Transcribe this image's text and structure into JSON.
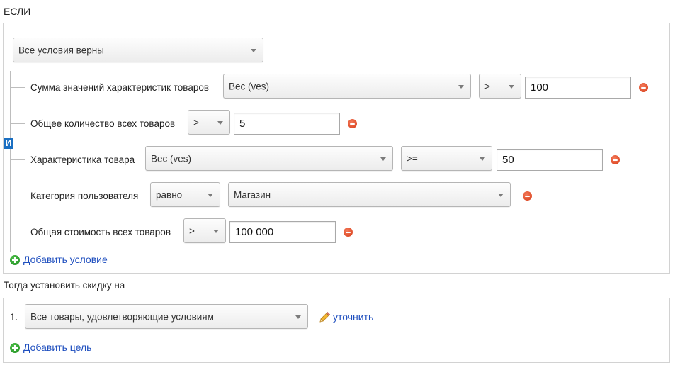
{
  "if_section": {
    "heading": "ЕСЛИ",
    "mode_select": "Все условия верны",
    "and_badge": "И",
    "conditions": [
      {
        "label": "Сумма значений характеристик товаров",
        "attribute": "Вес (ves)",
        "operator": ">",
        "value": "100"
      },
      {
        "label": "Общее количество всех товаров",
        "operator": ">",
        "value": "5"
      },
      {
        "label": "Характеристика товара",
        "attribute": "Вес (ves)",
        "operator": ">=",
        "value": "50"
      },
      {
        "label": "Категория пользователя",
        "operator": "равно",
        "value": "Магазин"
      },
      {
        "label": "Общая стоимость всех товаров",
        "operator": ">",
        "value": "100 000"
      }
    ],
    "add_condition": "Добавить условие"
  },
  "then_section": {
    "heading": "Тогда установить скидку на",
    "targets": [
      {
        "number": "1.",
        "target": "Все товары, удовлетворяющие условиям",
        "refine_link": "уточнить"
      }
    ],
    "add_target": "Добавить цель"
  },
  "icons": {
    "remove": "minus-circle-icon",
    "add": "plus-circle-icon",
    "edit": "pencil-icon"
  },
  "colors": {
    "link": "#1f4fbf",
    "remove": "#d63b16",
    "add": "#1f8d21",
    "badge": "#1a6fc2"
  }
}
